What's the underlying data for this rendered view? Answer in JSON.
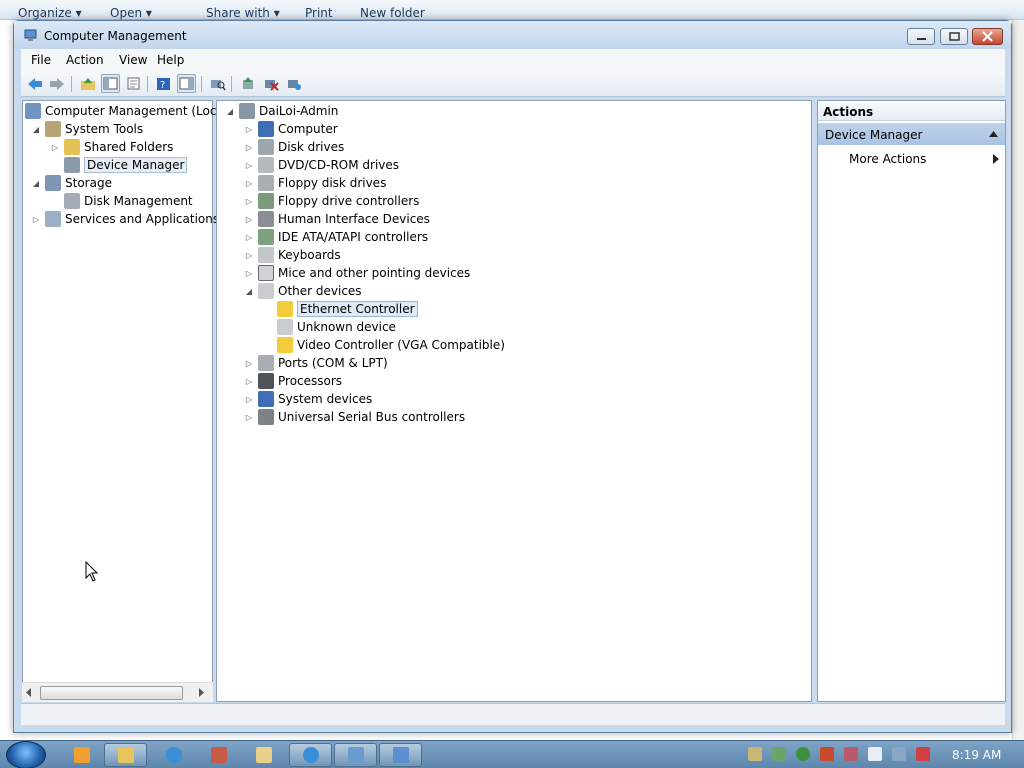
{
  "background_window": {
    "toolbar": [
      "Organize ▾",
      "Open ▾",
      "Share with ▾",
      "Print",
      "New folder"
    ]
  },
  "window": {
    "title": "Computer Management",
    "menu": [
      "File",
      "Action",
      "View",
      "Help"
    ]
  },
  "left_tree": [
    {
      "label": "Computer Management (Local",
      "icon": "computer-management-icon"
    },
    {
      "label": "System Tools",
      "icon": "tools-icon"
    },
    {
      "label": "Shared Folders",
      "icon": "shared-folder-icon"
    },
    {
      "label": "Device Manager",
      "icon": "device-manager-icon",
      "selected": true
    },
    {
      "label": "Storage",
      "icon": "storage-icon"
    },
    {
      "label": "Disk Management",
      "icon": "disk-icon"
    },
    {
      "label": "Services and Applications",
      "icon": "services-icon"
    }
  ],
  "device_tree": {
    "root": "DaiLoi-Admin",
    "categories": [
      "Computer",
      "Disk drives",
      "DVD/CD-ROM drives",
      "Floppy disk drives",
      "Floppy drive controllers",
      "Human Interface Devices",
      "IDE ATA/ATAPI controllers",
      "Keyboards",
      "Mice and other pointing devices",
      "Other devices",
      "Ethernet Controller",
      "Unknown device",
      "Video Controller (VGA Compatible)",
      "Ports (COM & LPT)",
      "Processors",
      "System devices",
      "Universal Serial Bus controllers"
    ]
  },
  "actions": {
    "header": "Actions",
    "section": "Device Manager",
    "more": "More Actions"
  },
  "taskbar": {
    "clock": "8:19 AM"
  },
  "colors": {
    "selection": "#dfeaf7",
    "actions_section": "#b4cbe6",
    "taskbar": "#6b93b8"
  }
}
